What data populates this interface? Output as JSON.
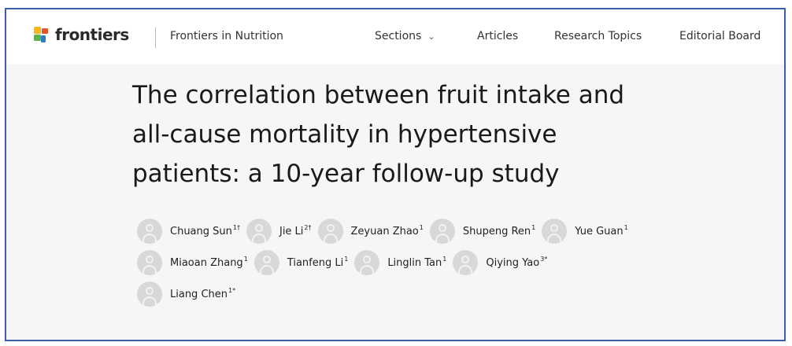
{
  "header": {
    "logo_text": "frontiers",
    "journal": "Frontiers in Nutrition",
    "nav": [
      {
        "label": "Sections",
        "chevron": "⌄"
      },
      {
        "label": "Articles"
      },
      {
        "label": "Research Topics"
      },
      {
        "label": "Editorial Board"
      }
    ]
  },
  "article": {
    "title_lines": [
      "The correlation between fruit intake and",
      "all-cause mortality in hypertensive",
      "patients: a 10-year follow-up study"
    ]
  },
  "authors": [
    {
      "name": "Chuang Sun",
      "sup": "1†"
    },
    {
      "name": "Jie Li",
      "sup": "2†"
    },
    {
      "name": "Zeyuan Zhao",
      "sup": "1"
    },
    {
      "name": "Shupeng Ren",
      "sup": "1"
    },
    {
      "name": "Yue Guan",
      "sup": "1"
    },
    {
      "name": "Miaoan Zhang",
      "sup": "1"
    },
    {
      "name": "Tianfeng Li",
      "sup": "1"
    },
    {
      "name": "Linglin Tan",
      "sup": "1"
    },
    {
      "name": "Qiying Yao",
      "sup": "3*"
    },
    {
      "name": "Liang Chen",
      "sup": "1*"
    }
  ],
  "colors": {
    "frame_border": "#3a5ea8",
    "logo_yellow": "#f6b719",
    "logo_orange": "#e8542a",
    "logo_green": "#5ab54b",
    "logo_blue": "#2e7dc2"
  }
}
